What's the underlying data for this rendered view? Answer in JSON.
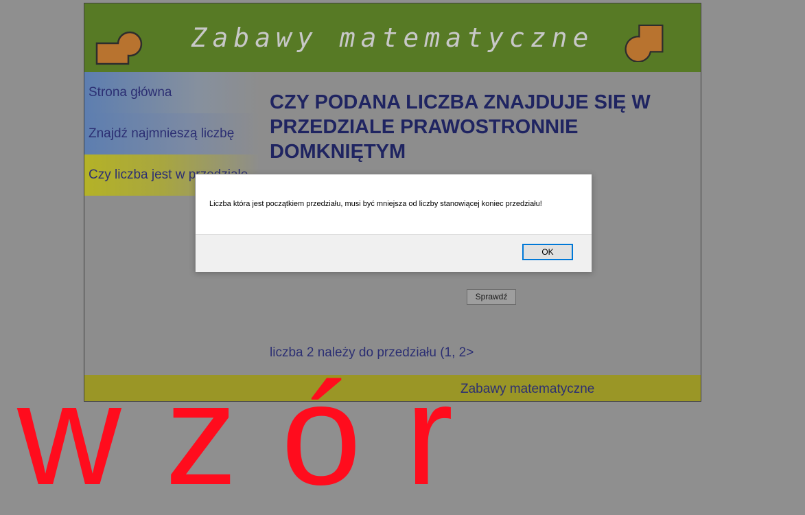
{
  "header": {
    "title": "Zabawy matematyczne"
  },
  "sidebar": {
    "items": [
      {
        "label": "Strona główna"
      },
      {
        "label": "Znajdź najmnieszą liczbę"
      },
      {
        "label": "Czy liczba jest w przedziale"
      }
    ]
  },
  "main": {
    "title": "CZY PODANA LICZBA ZNAJDUJE SIĘ W PRZEDZIALE PRAWOSTRONNIE DOMKNIĘTYM",
    "check_button": "Sprawdź",
    "result": "liczba 2 należy do przedziału (1, 2>"
  },
  "footer": {
    "text": "Zabawy matematyczne"
  },
  "dialog": {
    "message": "Liczba która jest początkiem przedziału, musi być mniejsza od liczby stanowiącej koniec przedziału!",
    "ok_label": "OK"
  },
  "watermark": {
    "text": "wzór"
  },
  "colors": {
    "header_bg": "#577a25",
    "footer_bg": "#9a9626",
    "logo_fill": "#b8732f",
    "title_text": "#1f2461",
    "watermark": "#ff0c1d",
    "dialog_accent": "#0078d7"
  }
}
